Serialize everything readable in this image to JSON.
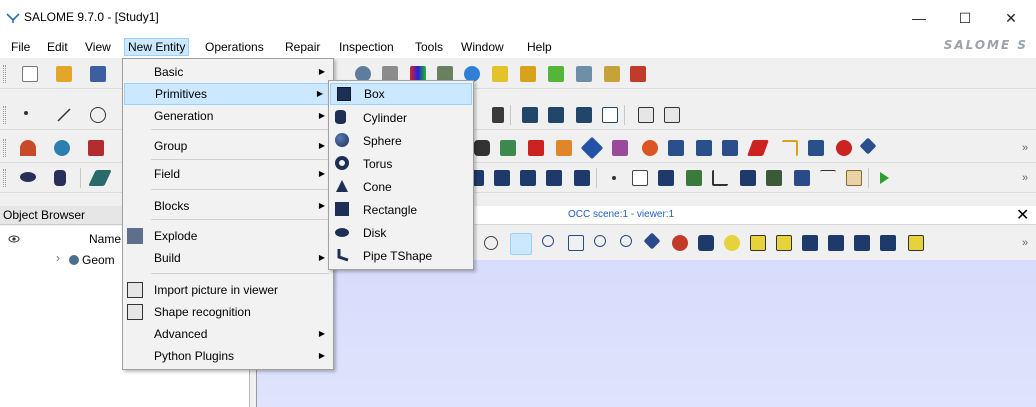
{
  "window": {
    "title": "SALOME 9.7.0 - [Study1]",
    "logo_text": "SALOME S",
    "controls": {
      "minimize": "—",
      "maximize": "☐",
      "close": "✕"
    }
  },
  "menubar": {
    "items": [
      "File",
      "Edit",
      "View",
      "New Entity",
      "Operations",
      "Repair",
      "Inspection",
      "Tools",
      "Window",
      "Help"
    ],
    "active": "New Entity"
  },
  "new_entity_menu": {
    "items": [
      {
        "label": "Basic",
        "submenu": true
      },
      {
        "label": "Primitives",
        "submenu": true
      },
      {
        "label": "Generation",
        "submenu": true
      },
      {
        "label": "Group",
        "submenu": true
      },
      {
        "label": "Field",
        "submenu": true
      },
      {
        "label": "Blocks",
        "submenu": true
      },
      {
        "label": "Explode",
        "submenu": false
      },
      {
        "label": "Build",
        "submenu": true
      },
      {
        "label": "Import picture in viewer",
        "submenu": false
      },
      {
        "label": "Shape recognition",
        "submenu": false
      },
      {
        "label": "Advanced",
        "submenu": true
      },
      {
        "label": "Python Plugins",
        "submenu": true
      }
    ],
    "highlighted": "Primitives"
  },
  "primitives_menu": {
    "items": [
      "Box",
      "Cylinder",
      "Sphere",
      "Torus",
      "Cone",
      "Rectangle",
      "Disk",
      "Pipe TShape"
    ],
    "highlighted": "Box"
  },
  "object_browser": {
    "title": "Object Browser",
    "column_name": "Name",
    "tree_item": "Geom"
  },
  "viewer": {
    "title": "OCC scene:1 - viewer:1",
    "close": "✕"
  },
  "colors": {
    "highlight": "#cce8ff",
    "highlight_border": "#99d1ff",
    "viewer_bg": "#d6dcfb",
    "viewer_title": "#1f5fbf"
  }
}
